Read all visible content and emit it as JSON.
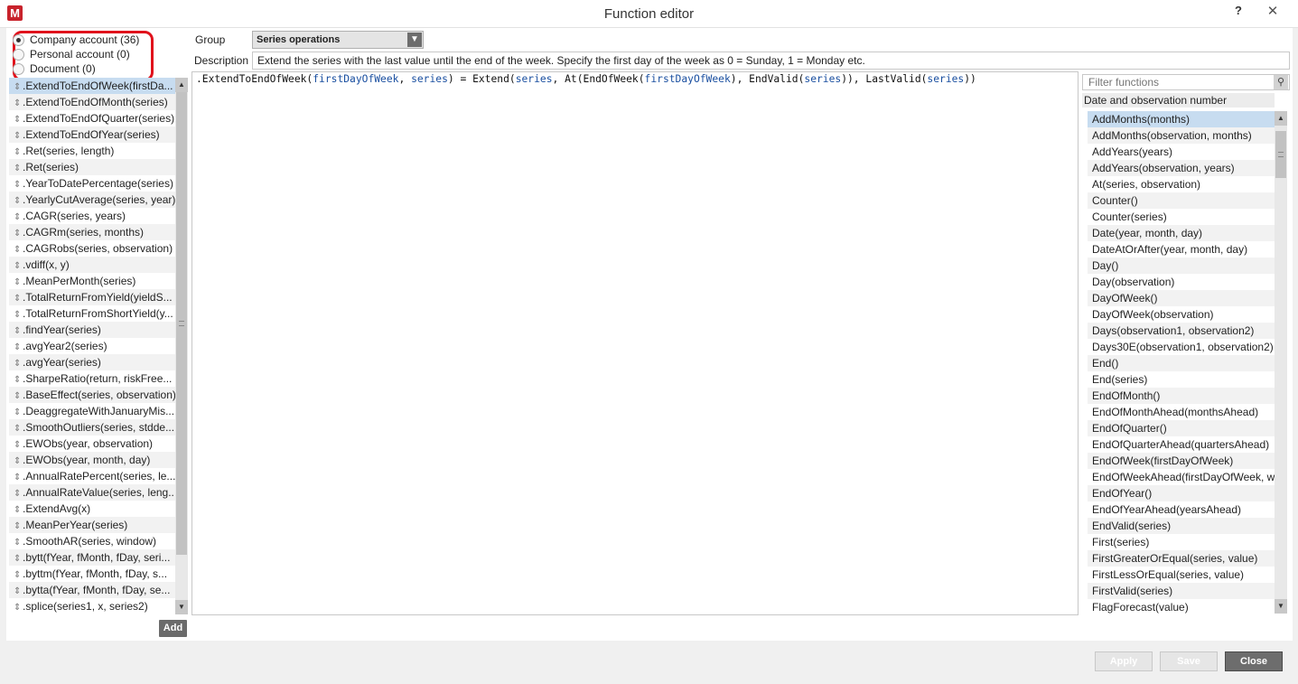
{
  "window": {
    "title": "Function editor",
    "logo": "M",
    "help": "?",
    "close": "✕"
  },
  "accounts": [
    {
      "label": "Company account (36)",
      "checked": true
    },
    {
      "label": "Personal account (0)",
      "checked": false
    },
    {
      "label": "Document (0)",
      "checked": false
    }
  ],
  "functions": [
    ".ExtendToEndOfWeek(firstDa...",
    ".ExtendToEndOfMonth(series)",
    ".ExtendToEndOfQuarter(series)",
    ".ExtendToEndOfYear(series)",
    ".Ret(series, length)",
    ".Ret(series)",
    ".YearToDatePercentage(series)",
    ".YearlyCutAverage(series, year)",
    ".CAGR(series, years)",
    ".CAGRm(series, months)",
    ".CAGRobs(series, observation)",
    ".vdiff(x, y)",
    ".MeanPerMonth(series)",
    ".TotalReturnFromYield(yieldS...",
    ".TotalReturnFromShortYield(y...",
    ".findYear(series)",
    ".avgYear2(series)",
    ".avgYear(series)",
    ".SharpeRatio(return, riskFree...",
    ".BaseEffect(series, observation)",
    ".DeaggregateWithJanuaryMis...",
    ".SmoothOutliers(series, stdde...",
    ".EWObs(year, observation)",
    ".EWObs(year, month, day)",
    ".AnnualRatePercent(series, le...",
    ".AnnualRateValue(series, leng...",
    ".ExtendAvg(x)",
    ".MeanPerYear(series)",
    ".SmoothAR(series, window)",
    ".bytt(fYear, fMonth, fDay, seri...",
    ".byttm(fYear, fMonth, fDay, s...",
    ".bytta(fYear, fMonth, fDay, se...",
    ".splice(series1, x, series2)"
  ],
  "add_label": "Add",
  "group": {
    "label": "Group",
    "value": "Series operations"
  },
  "description": {
    "label": "Description",
    "value": "Extend the series with the last value until the end of the week. Specify the first day of the week as 0 = Sunday, 1 = Monday etc."
  },
  "editor": {
    "code": [
      {
        "t": ".ExtendToEndOfWeek(",
        "p": false
      },
      {
        "t": "firstDayOfWeek",
        "p": true
      },
      {
        "t": ", ",
        "p": false
      },
      {
        "t": "series",
        "p": true
      },
      {
        "t": ") = Extend(",
        "p": false
      },
      {
        "t": "series",
        "p": true
      },
      {
        "t": ", At(EndOfWeek(",
        "p": false
      },
      {
        "t": "firstDayOfWeek",
        "p": true
      },
      {
        "t": "), EndValid(",
        "p": false
      },
      {
        "t": "series",
        "p": true
      },
      {
        "t": ")), LastValid(",
        "p": false
      },
      {
        "t": "series",
        "p": true
      },
      {
        "t": "))",
        "p": false
      }
    ]
  },
  "filter_placeholder": "Filter functions",
  "category": "Date and observation number",
  "builtins": [
    "AddMonths(months)",
    "AddMonths(observation, months)",
    "AddYears(years)",
    "AddYears(observation, years)",
    "At(series, observation)",
    "Counter()",
    "Counter(series)",
    "Date(year, month, day)",
    "DateAtOrAfter(year, month, day)",
    "Day()",
    "Day(observation)",
    "DayOfWeek()",
    "DayOfWeek(observation)",
    "Days(observation1, observation2)",
    "Days30E(observation1, observation2)",
    "End()",
    "End(series)",
    "EndOfMonth()",
    "EndOfMonthAhead(monthsAhead)",
    "EndOfQuarter()",
    "EndOfQuarterAhead(quartersAhead)",
    "EndOfWeek(firstDayOfWeek)",
    "EndOfWeekAhead(firstDayOfWeek, w",
    "EndOfYear()",
    "EndOfYearAhead(yearsAhead)",
    "EndValid(series)",
    "First(series)",
    "FirstGreaterOrEqual(series, value)",
    "FirstLessOrEqual(series, value)",
    "FirstValid(series)",
    "FlagForecast(value)"
  ],
  "buttons": {
    "apply": "Apply",
    "save": "Save",
    "close": "Close"
  }
}
